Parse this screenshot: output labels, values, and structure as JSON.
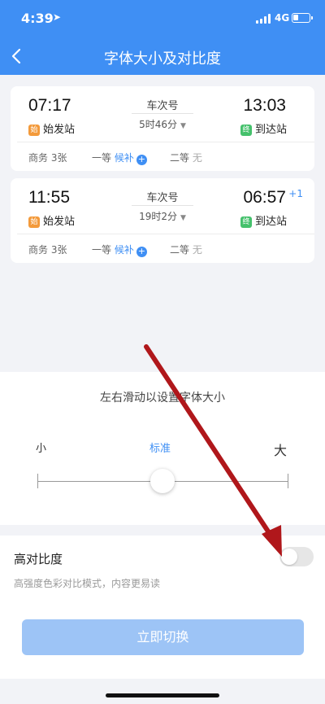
{
  "status_bar": {
    "time": "4:39",
    "network": "4G"
  },
  "header": {
    "title": "字体大小及对比度"
  },
  "trains": [
    {
      "depart_time": "07:17",
      "arrive_time": "13:03",
      "train_label": "车次号",
      "duration": "5时46分",
      "depart_tag": "始",
      "depart_station": "始发站",
      "arrive_tag": "终",
      "arrive_station": "到达站",
      "next_day": "",
      "seats": {
        "business_label": "商务",
        "business_value": "3张",
        "first_label": "一等",
        "first_value": "候补",
        "second_label": "二等",
        "second_value": "无"
      }
    },
    {
      "depart_time": "11:55",
      "arrive_time": "06:57",
      "train_label": "车次号",
      "duration": "19时2分",
      "depart_tag": "始",
      "depart_station": "始发站",
      "arrive_tag": "终",
      "arrive_station": "到达站",
      "next_day": "+1",
      "seats": {
        "business_label": "商务",
        "business_value": "3张",
        "first_label": "一等",
        "first_value": "候补",
        "second_label": "二等",
        "second_value": "无"
      }
    }
  ],
  "font_size": {
    "hint": "左右滑动以设置字体大小",
    "small_label": "小",
    "standard_label": "标准",
    "large_label": "大",
    "current_step": 2,
    "step_count": 4
  },
  "high_contrast": {
    "title": "高对比度",
    "description": "高强度色彩对比模式，内容更易读",
    "enabled": false
  },
  "action_button": {
    "label": "立即切换"
  },
  "colors": {
    "accent": "#3f8ff4",
    "header_bg": "#3f8ff4",
    "button_disabled": "#9dc4f6",
    "annotation_arrow": "#b0171b",
    "depart_tag": "#f39a3b",
    "arrive_tag": "#45c16c"
  },
  "icons": {
    "back": "chevron-left-icon",
    "location": "location-arrow-icon",
    "signal": "signal-bars-icon",
    "battery": "battery-icon",
    "add": "plus-circle-icon",
    "expand": "caret-down-icon"
  }
}
